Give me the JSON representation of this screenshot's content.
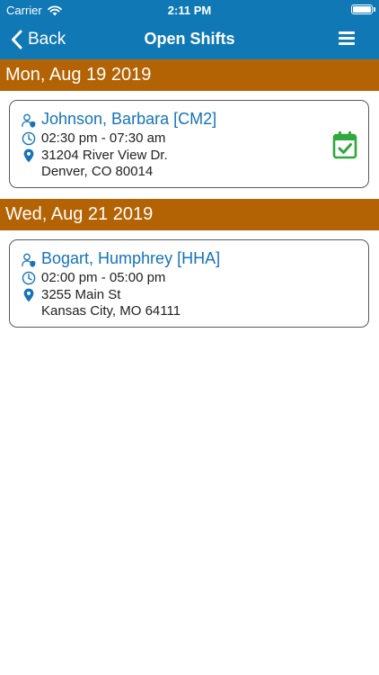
{
  "status_bar": {
    "carrier": "Carrier",
    "time": "2:11 PM"
  },
  "nav": {
    "back_label": "Back",
    "title": "Open Shifts"
  },
  "colors": {
    "nav_bg": "#0f78b5",
    "date_header_bg": "#b46304",
    "name_blue": "#1673b8",
    "calendar_green": "#2fa83c"
  },
  "shifts": [
    {
      "date": "Mon, Aug 19 2019",
      "client": "Johnson, Barbara [CM2]",
      "time_range": "02:30 pm - 07:30 am",
      "address_line1": "31204 River View Dr.",
      "address_line2": "Denver, CO 80014",
      "icons": [
        "user-shield-icon",
        "clock-icon",
        "location-pin-icon",
        "calendar-check-icon"
      ]
    },
    {
      "date": "Wed, Aug 21 2019",
      "client": "Bogart, Humphrey [HHA]",
      "time_range": "02:00 pm - 05:00 pm",
      "address_line1": "3255 Main St",
      "address_line2": "Kansas City, MO 64111",
      "icons": [
        "user-shield-icon",
        "clock-icon",
        "location-pin-icon"
      ]
    }
  ]
}
